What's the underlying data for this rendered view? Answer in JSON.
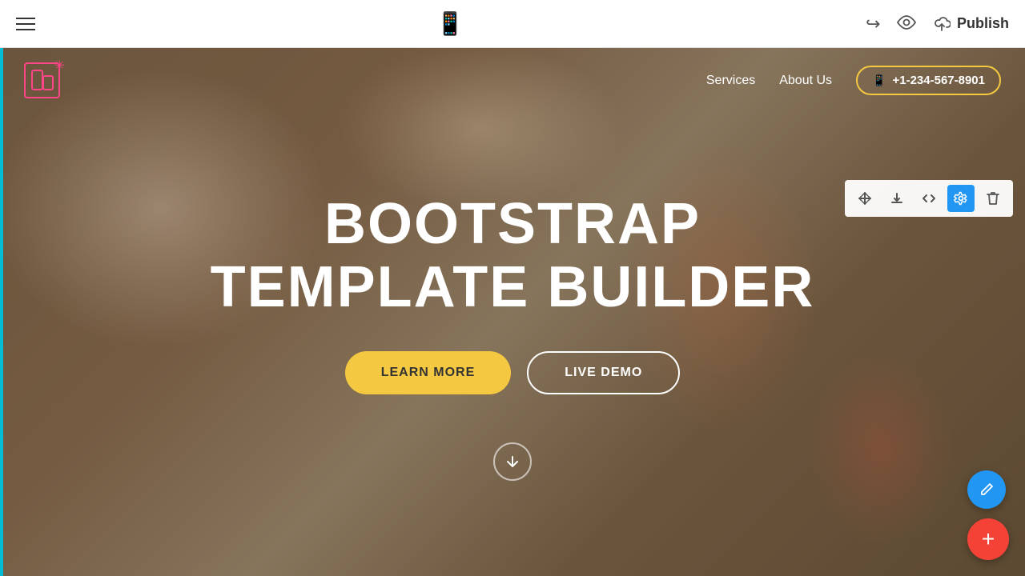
{
  "toolbar": {
    "hamburger_label": "menu",
    "undo_symbol": "↩",
    "preview_symbol": "👁",
    "cloud_symbol": "☁",
    "publish_label": "Publish"
  },
  "site": {
    "nav": {
      "services_label": "Services",
      "about_label": "About Us",
      "phone": "+1-234-567-8901"
    },
    "hero": {
      "title_line1": "BOOTSTRAP",
      "title_line2": "TEMPLATE BUILDER",
      "btn_learn_more": "LEARN MORE",
      "btn_live_demo": "LIVE DEMO"
    }
  },
  "block_controls": {
    "move_up_down": "⇅",
    "download": "⬇",
    "code": "</>",
    "settings": "⚙",
    "delete": "🗑"
  },
  "fab": {
    "edit_icon": "✏",
    "add_icon": "+"
  }
}
